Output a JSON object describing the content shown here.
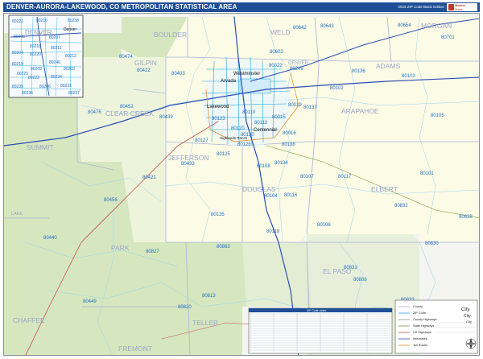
{
  "title": "DENVER-AURORA-LAKEWOOD, CO METROPOLITAN STATISTICAL AREA",
  "edition": "2023 ZIP Code Basic Edition",
  "logo": {
    "line1": "Market",
    "line2": "Maps"
  },
  "colors": {
    "title_bg": "#1f4f96",
    "metro_fill": "#fbfbe6",
    "forest": "#d6e7bf",
    "outside": "#f4f4f0",
    "county_line": "#a7b3d6",
    "zip_line": "#1aa3e0",
    "zip_label": "#1e6fc8",
    "county_label": "#9aa6c7",
    "highway": "#2a4db5"
  },
  "counties": [
    "BOULDER",
    "WELD",
    "MORGAN",
    "ADAMS",
    "GILPIN",
    "CLEAR CREEK",
    "DENVER",
    "ARAPAHOE",
    "SUMMIT",
    "JEFFERSON",
    "DOUGLAS",
    "ELBERT",
    "PARK",
    "EL PASO",
    "CHAFFEE",
    "TELLER",
    "FREMONT",
    "LAKE"
  ],
  "cities": [
    "Westminster",
    "Arvada",
    "Lakewood",
    "Centennial",
    "Highlands Ranch",
    "Denver"
  ],
  "zips": [
    "80642",
    "80643",
    "80654",
    "80701",
    "80603",
    "80136",
    "80103",
    "80102",
    "80137",
    "80105",
    "80474",
    "80403",
    "80422",
    "80452",
    "80439",
    "80476",
    "80433",
    "80421",
    "80456",
    "80440",
    "80827",
    "80449",
    "80820",
    "80813",
    "80863",
    "80135",
    "80125",
    "80108",
    "80134",
    "80116",
    "80104",
    "80118",
    "80107",
    "80117",
    "80106",
    "80101",
    "80832",
    "80828",
    "80830",
    "80831",
    "80808",
    "80833",
    "80015",
    "80016",
    "80138",
    "80022",
    "80249",
    "80019",
    "80127",
    "80123",
    "80120",
    "80112",
    "80130",
    "80126",
    "80110"
  ],
  "inset": {
    "title": "DENVER",
    "city": "Denver",
    "zips": [
      "80221",
      "80216",
      "80238",
      "80205",
      "80207",
      "80204",
      "80218",
      "80220",
      "80219",
      "80209",
      "80224",
      "80222",
      "80231",
      "80235",
      "80236",
      "80237",
      "80246",
      "80223",
      "80211",
      "80212",
      "80203",
      "80206"
    ]
  },
  "index_table": {
    "title": "ZIP Code Index"
  },
  "legend": {
    "items": [
      "County",
      "ZIP Code",
      "County Highways",
      "State Highways",
      "US Highways",
      "Interstates",
      "Toll Roads"
    ],
    "places": [
      "City",
      "City",
      "City"
    ]
  }
}
